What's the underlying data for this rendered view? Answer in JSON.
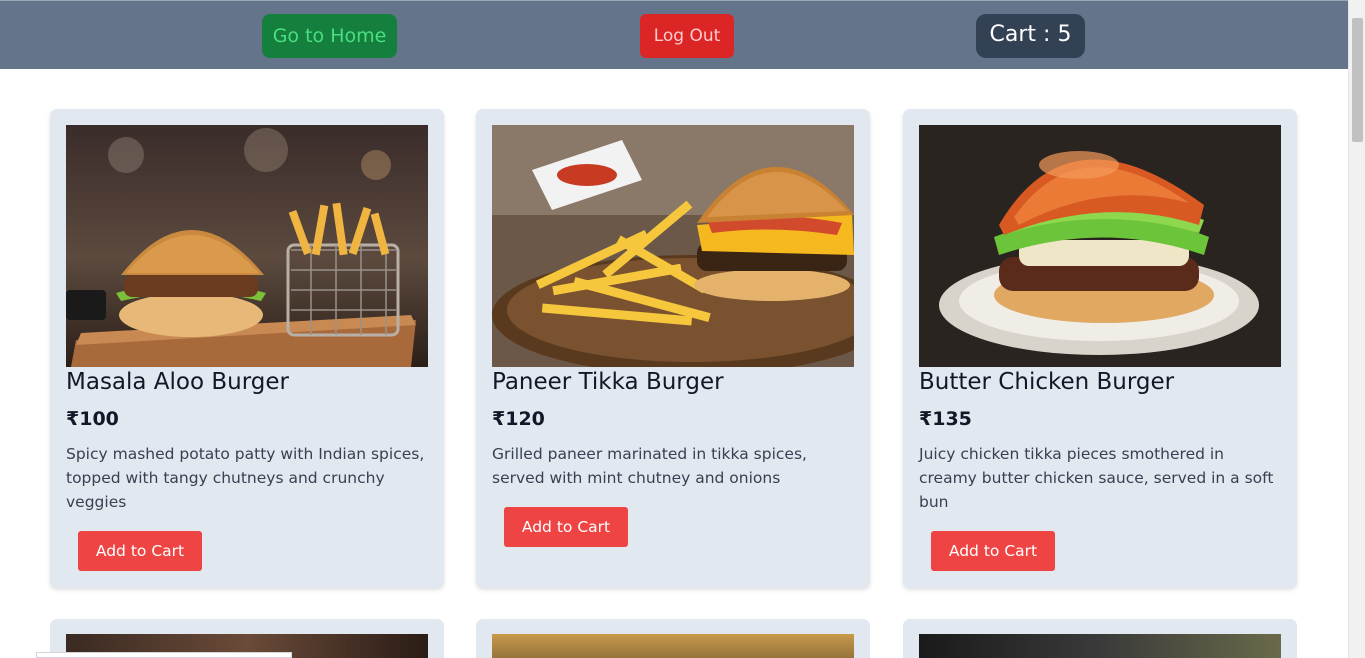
{
  "nav": {
    "home_label": "Go to Home",
    "logout_label": "Log Out",
    "cart_label": "Cart : 5"
  },
  "products": [
    {
      "name": "Masala Aloo Burger",
      "price": "₹100",
      "description": "Spicy mashed potato patty with Indian spices, topped with tangy chutneys and crunchy veggies",
      "button": "Add to Cart"
    },
    {
      "name": "Paneer Tikka Burger",
      "price": "₹120",
      "description": "Grilled paneer marinated in tikka spices, served with mint chutney and onions",
      "button": "Add to Cart"
    },
    {
      "name": "Butter Chicken Burger",
      "price": "₹135",
      "description": "Juicy chicken tikka pieces smothered in creamy butter chicken sauce, served in a soft bun",
      "button": "Add to Cart"
    }
  ],
  "colors": {
    "header_bg": "#64748b",
    "card_bg": "#e2e8f0",
    "accent_red": "#ef4444",
    "home_green": "#15803d"
  }
}
